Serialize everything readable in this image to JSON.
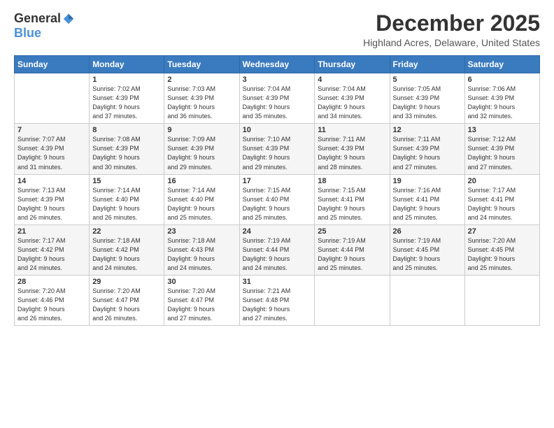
{
  "logo": {
    "general": "General",
    "blue": "Blue"
  },
  "title": "December 2025",
  "location": "Highland Acres, Delaware, United States",
  "days_header": [
    "Sunday",
    "Monday",
    "Tuesday",
    "Wednesday",
    "Thursday",
    "Friday",
    "Saturday"
  ],
  "weeks": [
    [
      {
        "day": "",
        "info": ""
      },
      {
        "day": "1",
        "info": "Sunrise: 7:02 AM\nSunset: 4:39 PM\nDaylight: 9 hours\nand 37 minutes."
      },
      {
        "day": "2",
        "info": "Sunrise: 7:03 AM\nSunset: 4:39 PM\nDaylight: 9 hours\nand 36 minutes."
      },
      {
        "day": "3",
        "info": "Sunrise: 7:04 AM\nSunset: 4:39 PM\nDaylight: 9 hours\nand 35 minutes."
      },
      {
        "day": "4",
        "info": "Sunrise: 7:04 AM\nSunset: 4:39 PM\nDaylight: 9 hours\nand 34 minutes."
      },
      {
        "day": "5",
        "info": "Sunrise: 7:05 AM\nSunset: 4:39 PM\nDaylight: 9 hours\nand 33 minutes."
      },
      {
        "day": "6",
        "info": "Sunrise: 7:06 AM\nSunset: 4:39 PM\nDaylight: 9 hours\nand 32 minutes."
      }
    ],
    [
      {
        "day": "7",
        "info": "Sunrise: 7:07 AM\nSunset: 4:39 PM\nDaylight: 9 hours\nand 31 minutes."
      },
      {
        "day": "8",
        "info": "Sunrise: 7:08 AM\nSunset: 4:39 PM\nDaylight: 9 hours\nand 30 minutes."
      },
      {
        "day": "9",
        "info": "Sunrise: 7:09 AM\nSunset: 4:39 PM\nDaylight: 9 hours\nand 29 minutes."
      },
      {
        "day": "10",
        "info": "Sunrise: 7:10 AM\nSunset: 4:39 PM\nDaylight: 9 hours\nand 29 minutes."
      },
      {
        "day": "11",
        "info": "Sunrise: 7:11 AM\nSunset: 4:39 PM\nDaylight: 9 hours\nand 28 minutes."
      },
      {
        "day": "12",
        "info": "Sunrise: 7:11 AM\nSunset: 4:39 PM\nDaylight: 9 hours\nand 27 minutes."
      },
      {
        "day": "13",
        "info": "Sunrise: 7:12 AM\nSunset: 4:39 PM\nDaylight: 9 hours\nand 27 minutes."
      }
    ],
    [
      {
        "day": "14",
        "info": "Sunrise: 7:13 AM\nSunset: 4:39 PM\nDaylight: 9 hours\nand 26 minutes."
      },
      {
        "day": "15",
        "info": "Sunrise: 7:14 AM\nSunset: 4:40 PM\nDaylight: 9 hours\nand 26 minutes."
      },
      {
        "day": "16",
        "info": "Sunrise: 7:14 AM\nSunset: 4:40 PM\nDaylight: 9 hours\nand 25 minutes."
      },
      {
        "day": "17",
        "info": "Sunrise: 7:15 AM\nSunset: 4:40 PM\nDaylight: 9 hours\nand 25 minutes."
      },
      {
        "day": "18",
        "info": "Sunrise: 7:15 AM\nSunset: 4:41 PM\nDaylight: 9 hours\nand 25 minutes."
      },
      {
        "day": "19",
        "info": "Sunrise: 7:16 AM\nSunset: 4:41 PM\nDaylight: 9 hours\nand 25 minutes."
      },
      {
        "day": "20",
        "info": "Sunrise: 7:17 AM\nSunset: 4:41 PM\nDaylight: 9 hours\nand 24 minutes."
      }
    ],
    [
      {
        "day": "21",
        "info": "Sunrise: 7:17 AM\nSunset: 4:42 PM\nDaylight: 9 hours\nand 24 minutes."
      },
      {
        "day": "22",
        "info": "Sunrise: 7:18 AM\nSunset: 4:42 PM\nDaylight: 9 hours\nand 24 minutes."
      },
      {
        "day": "23",
        "info": "Sunrise: 7:18 AM\nSunset: 4:43 PM\nDaylight: 9 hours\nand 24 minutes."
      },
      {
        "day": "24",
        "info": "Sunrise: 7:19 AM\nSunset: 4:44 PM\nDaylight: 9 hours\nand 24 minutes."
      },
      {
        "day": "25",
        "info": "Sunrise: 7:19 AM\nSunset: 4:44 PM\nDaylight: 9 hours\nand 25 minutes."
      },
      {
        "day": "26",
        "info": "Sunrise: 7:19 AM\nSunset: 4:45 PM\nDaylight: 9 hours\nand 25 minutes."
      },
      {
        "day": "27",
        "info": "Sunrise: 7:20 AM\nSunset: 4:45 PM\nDaylight: 9 hours\nand 25 minutes."
      }
    ],
    [
      {
        "day": "28",
        "info": "Sunrise: 7:20 AM\nSunset: 4:46 PM\nDaylight: 9 hours\nand 26 minutes."
      },
      {
        "day": "29",
        "info": "Sunrise: 7:20 AM\nSunset: 4:47 PM\nDaylight: 9 hours\nand 26 minutes."
      },
      {
        "day": "30",
        "info": "Sunrise: 7:20 AM\nSunset: 4:47 PM\nDaylight: 9 hours\nand 27 minutes."
      },
      {
        "day": "31",
        "info": "Sunrise: 7:21 AM\nSunset: 4:48 PM\nDaylight: 9 hours\nand 27 minutes."
      },
      {
        "day": "",
        "info": ""
      },
      {
        "day": "",
        "info": ""
      },
      {
        "day": "",
        "info": ""
      }
    ]
  ]
}
